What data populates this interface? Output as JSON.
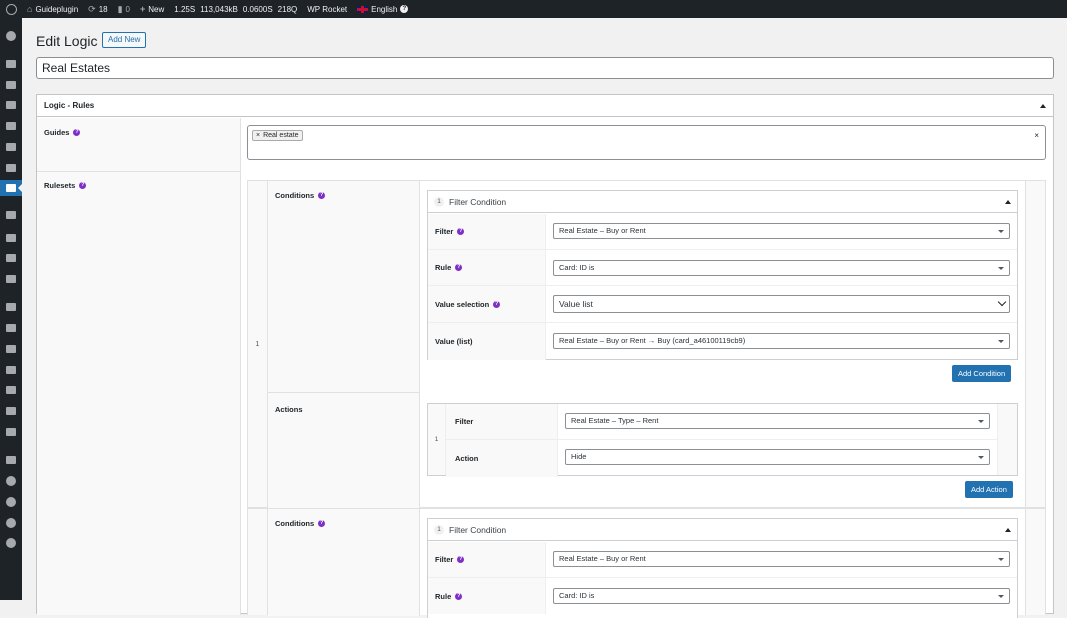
{
  "adminbar": {
    "site_name": "Guideplugin",
    "updates_count": "18",
    "comments_count": "0",
    "new_label": "New",
    "stat_time": "1.25S",
    "stat_memory": "113,043kB",
    "stat_query_time": "0.0600S",
    "stat_queries": "218Q",
    "wp_rocket": "WP Rocket",
    "language": "English"
  },
  "page": {
    "title": "Edit Logic",
    "add_new_label": "Add New",
    "post_title": "Real Estates"
  },
  "metabox": {
    "title": "Logic - Rules",
    "guides_label": "Guides",
    "guides_tag": "Real estate",
    "rulesets_label": "Rulesets"
  },
  "ruleset1": {
    "index": "1",
    "conditions_label": "Conditions",
    "condition": {
      "number": "1",
      "title": "Filter Condition",
      "filter_label": "Filter",
      "filter_value": "Real Estate – Buy or Rent",
      "rule_label": "Rule",
      "rule_value": "Card: ID is",
      "value_selection_label": "Value selection",
      "value_selection_value": "Value list",
      "value_list_label": "Value (list)",
      "value_list_value": "Real Estate – Buy or Rent → Buy (card_a46100119cb9)"
    },
    "add_condition_label": "Add Condition",
    "actions_label": "Actions",
    "action": {
      "index": "1",
      "filter_label": "Filter",
      "filter_value": "Real Estate – Type – Rent",
      "action_label": "Action",
      "action_value": "Hide"
    },
    "add_action_label": "Add Action"
  },
  "ruleset2": {
    "conditions_label": "Conditions",
    "condition": {
      "number": "1",
      "title": "Filter Condition",
      "filter_label": "Filter",
      "filter_value": "Real Estate – Buy or Rent",
      "rule_label": "Rule",
      "rule_value": "Card: ID is"
    }
  },
  "icons": {
    "sidebar": [
      "dashboard-icon",
      "pin-icon",
      "media-icon",
      "pages-icon",
      "comments-icon",
      "pin-icon",
      "pin-icon",
      "logic-icon",
      "forms-icon",
      "box-icon",
      "chart-icon",
      "megaphone-icon",
      "brush-icon",
      "plugins-icon",
      "users-icon",
      "tools-icon",
      "settings-icon",
      "table-icon",
      "mail-icon",
      "grid-icon",
      "rocket-icon",
      "seo-icon",
      "d-icon",
      "play-icon"
    ]
  },
  "colors": {
    "accent": "#2271b1",
    "help_icon": "#7f2ec8",
    "adminbar_bg": "#1d2327"
  }
}
